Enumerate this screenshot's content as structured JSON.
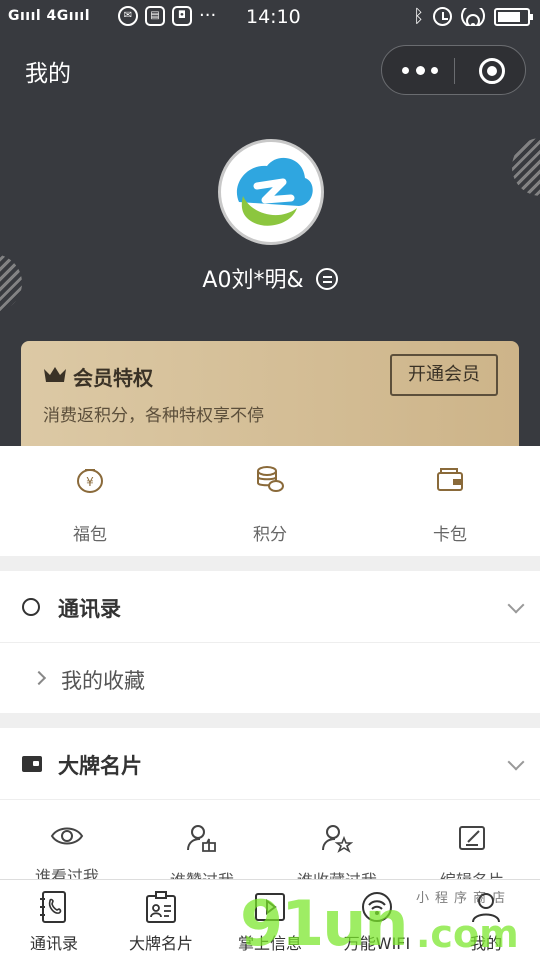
{
  "status_bar": {
    "signal": "Gıııl 4Gıııl",
    "app_icons": [
      "wechat-icon",
      "id-card-icon",
      "photo-app-icon"
    ],
    "more": "···",
    "time": "14:10"
  },
  "header": {
    "title": "我的"
  },
  "profile": {
    "nickname": "A0刘*明&"
  },
  "vip": {
    "title": "会员特权",
    "subtitle": "消费返积分，各种特权享不停",
    "button": "开通会员"
  },
  "wallet": {
    "items": [
      {
        "label": "福包",
        "icon": "coin-pouch-icon"
      },
      {
        "label": "积分",
        "icon": "coins-stack-icon"
      },
      {
        "label": "卡包",
        "icon": "wallet-icon"
      }
    ]
  },
  "contacts": {
    "title": "通讯录",
    "favorites": "我的收藏"
  },
  "cards": {
    "title": "大牌名片",
    "quick_actions": [
      {
        "label": "谁看过我",
        "icon": "eye-icon"
      },
      {
        "label": "谁赞过我",
        "icon": "person-thumbsup-icon"
      },
      {
        "label": "谁收藏过我",
        "icon": "person-star-icon"
      },
      {
        "label": "编辑名片",
        "icon": "edit-icon"
      }
    ]
  },
  "tabbar": {
    "tabs": [
      {
        "label": "通讯录",
        "icon": "phone-book-icon"
      },
      {
        "label": "大牌名片",
        "icon": "id-card-icon"
      },
      {
        "label": "掌上信息",
        "icon": "play-screen-icon"
      },
      {
        "label": "万能WIFI",
        "icon": "wifi-icon"
      },
      {
        "label": "我的",
        "icon": "user-icon"
      }
    ]
  },
  "watermark": {
    "brand": "91un",
    "domain": ".com",
    "tagline": "小程序商店"
  },
  "colors": {
    "header_bg": "#383a3f",
    "vip_gold": "#d6c19a",
    "watermark_green": "#78e628"
  }
}
